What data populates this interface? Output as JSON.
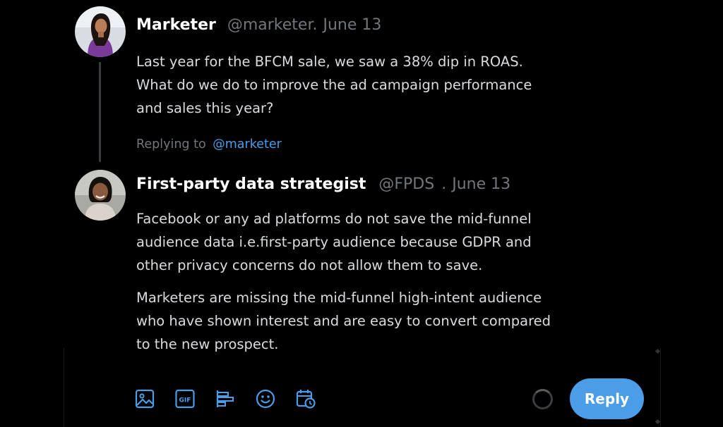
{
  "tweet1": {
    "name": "Marketer",
    "handle": "@marketer.",
    "date": "June 13",
    "lines": [
      "Last year for the BFCM sale, we saw a 38% dip in ROAS.",
      "What do we do to improve the ad campaign performance",
      "and sales this year?"
    ]
  },
  "replying": {
    "prefix": "Replying to",
    "mention": "@marketer"
  },
  "tweet2": {
    "name": "First-party data strategist",
    "handle": "@FPDS",
    "separator": ".",
    "date": "June 13",
    "para1": [
      "Facebook or any ad platforms do not save the mid-funnel",
      "audience data i.e.first-party audience because GDPR and",
      "other privacy concerns do not allow them to save."
    ],
    "para2": [
      "Marketers are missing the mid-funnel high-intent audience",
      "who have shown interest and are easy to convert compared",
      "to the new prospect."
    ]
  },
  "composer": {
    "gif_label": "GIF",
    "reply_label": "Reply"
  },
  "colors": {
    "accent": "#4a9de6",
    "muted": "#71767b",
    "background": "#000000"
  },
  "icons": [
    "image-icon",
    "gif-icon",
    "poll-icon",
    "emoji-icon",
    "schedule-icon"
  ]
}
